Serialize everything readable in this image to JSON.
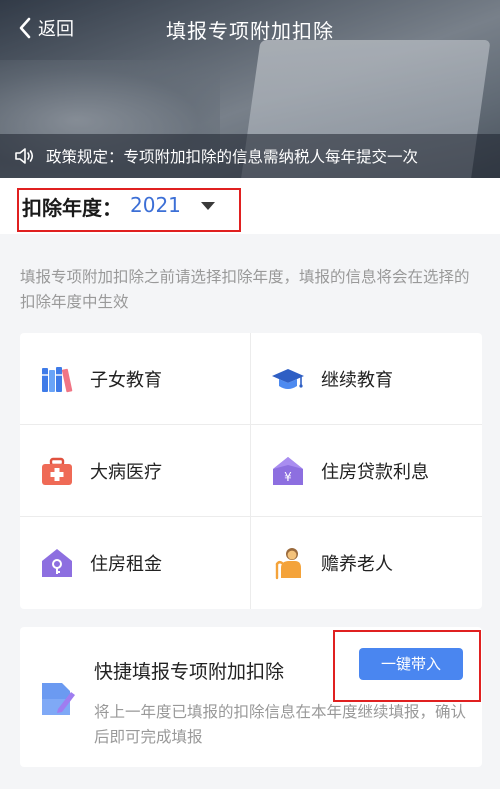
{
  "header": {
    "back_label": "返回",
    "title": "填报专项附加扣除"
  },
  "notice": {
    "text": "政策规定：专项附加扣除的信息需纳税人每年提交一次"
  },
  "year_selector": {
    "label": "扣除年度：",
    "value": "2021"
  },
  "hint": "填报专项附加扣除之前请选择扣除年度，填报的信息将会在选择的扣除年度中生效",
  "categories": [
    {
      "label": "子女教育",
      "icon": "books-icon"
    },
    {
      "label": "继续教育",
      "icon": "graduation-cap-icon"
    },
    {
      "label": "大病医疗",
      "icon": "medical-kit-icon"
    },
    {
      "label": "住房贷款利息",
      "icon": "house-loan-icon"
    },
    {
      "label": "住房租金",
      "icon": "house-rent-icon"
    },
    {
      "label": "赡养老人",
      "icon": "elderly-person-icon"
    }
  ],
  "quick_fill": {
    "title": "快捷填报专项附加扣除",
    "description": "将上一年度已填报的扣除信息在本年度继续填报，确认后即可完成填报",
    "button_label": "一键带入"
  },
  "colors": {
    "accent_blue": "#4a86f0",
    "link_blue": "#3c6fd6",
    "highlight_red": "#e02020"
  }
}
